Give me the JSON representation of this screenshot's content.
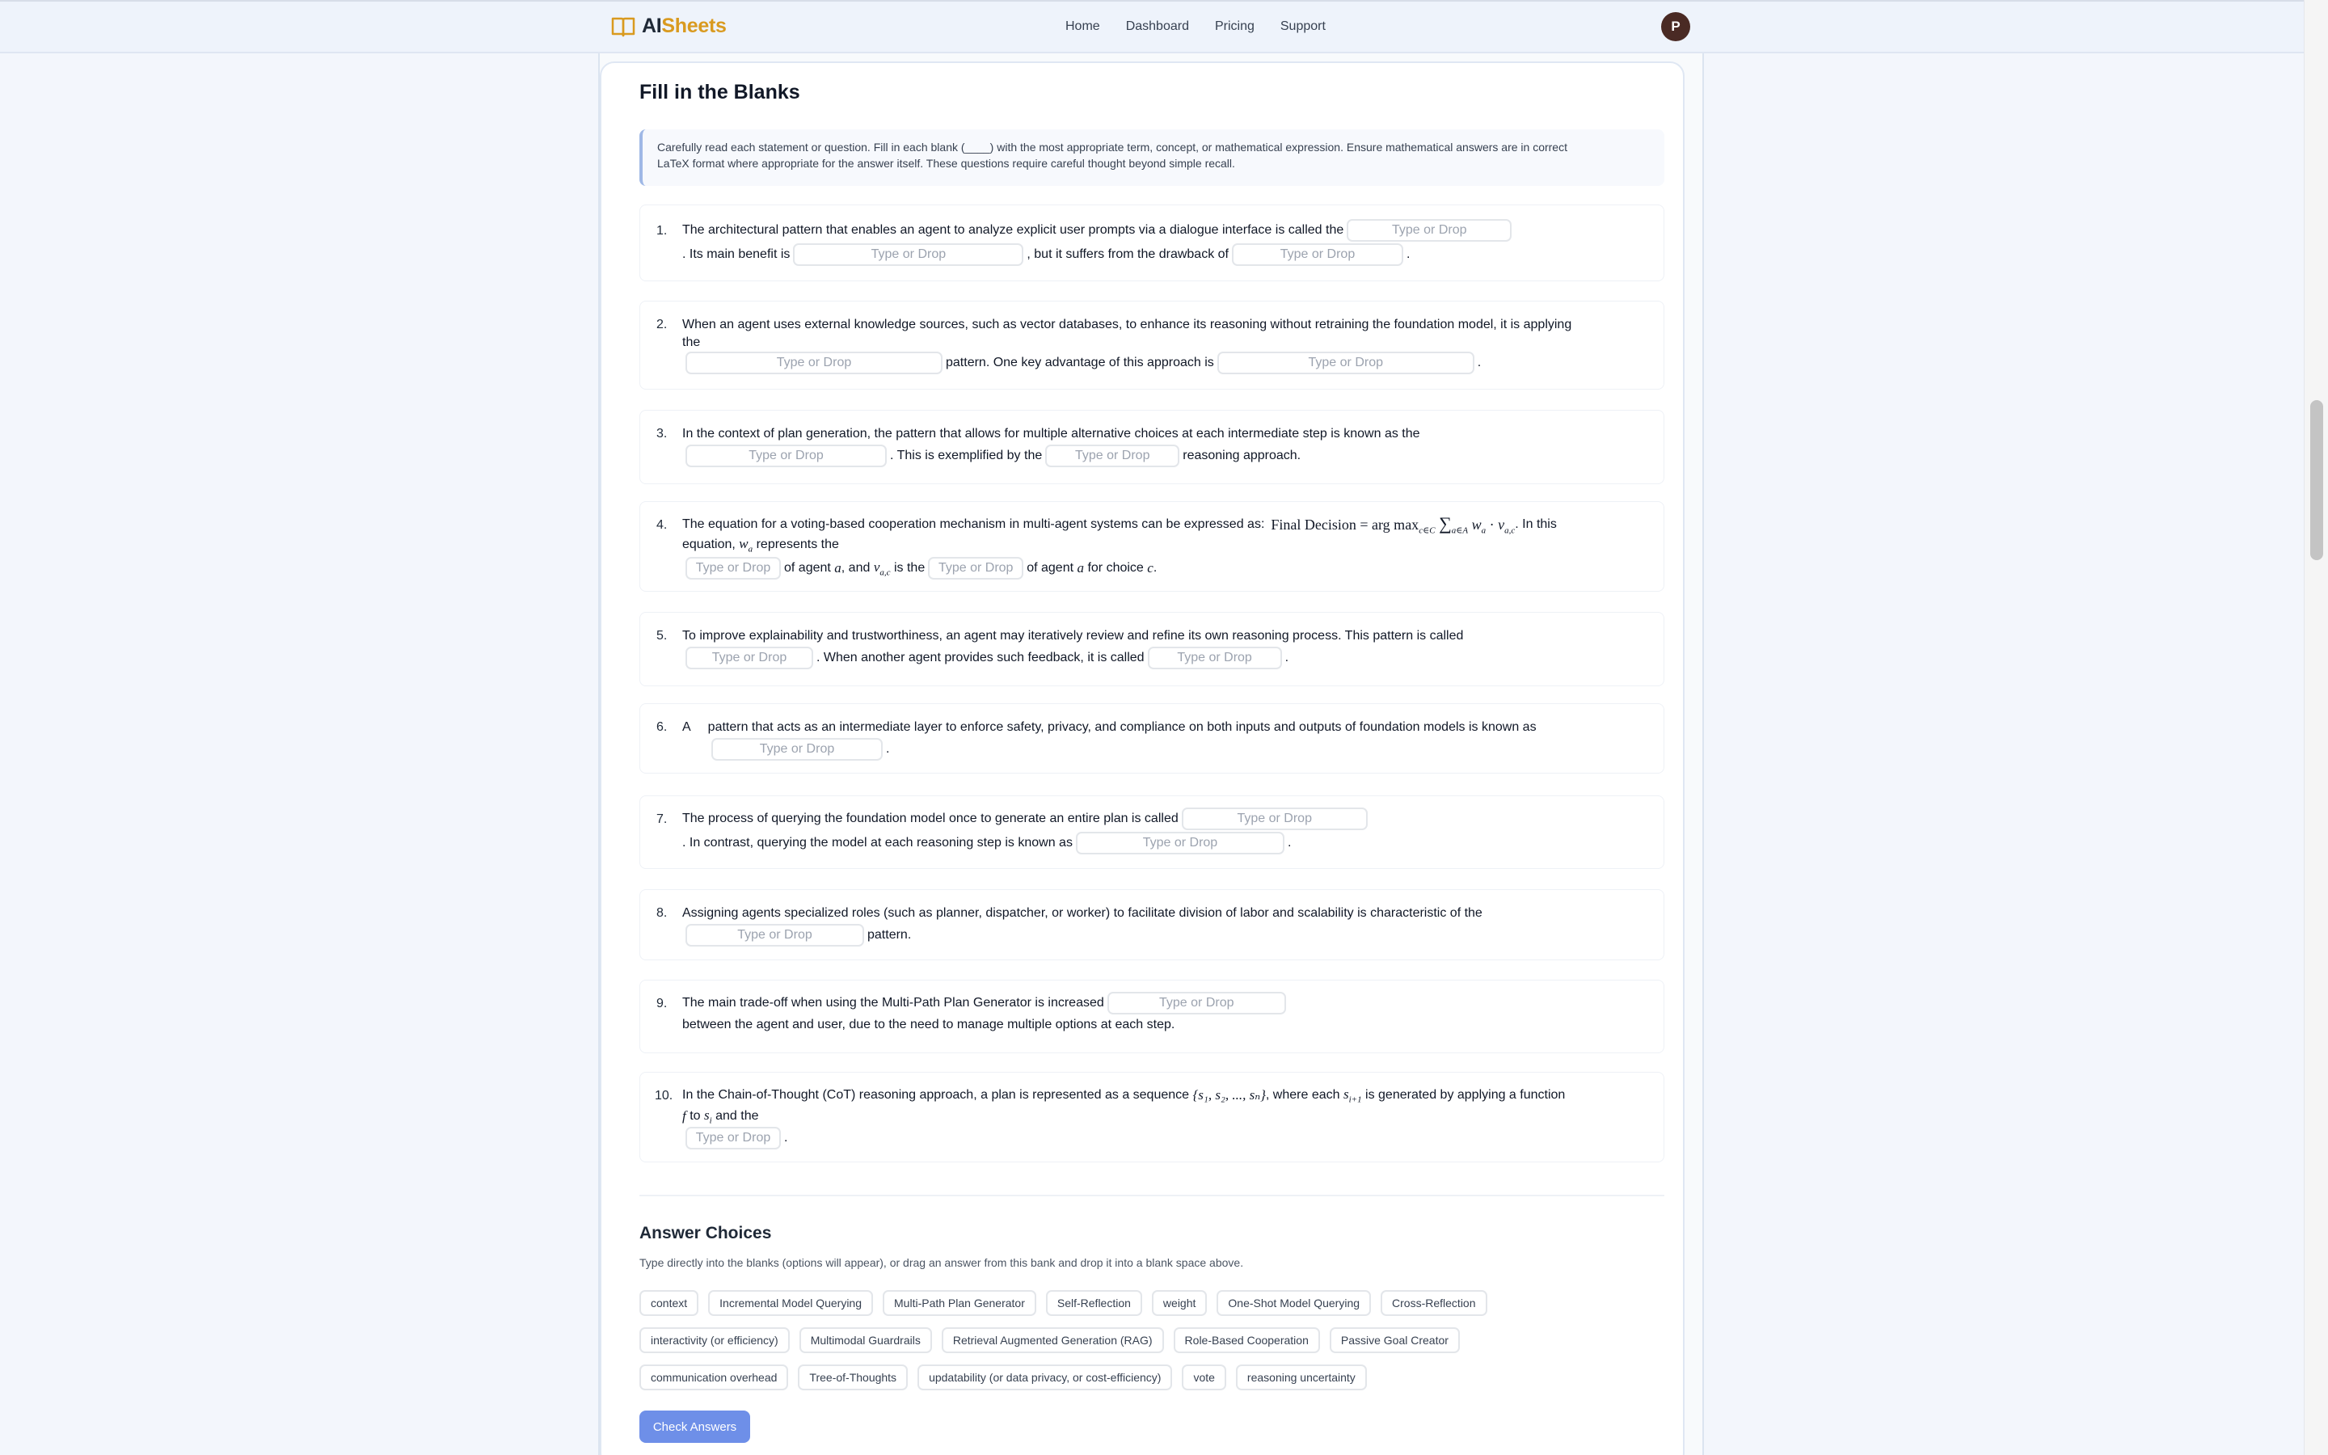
{
  "header": {
    "logo_ai": "AI",
    "logo_sheets": "Sheets",
    "nav": [
      "Home",
      "Dashboard",
      "Pricing",
      "Support"
    ],
    "avatar_initial": "P"
  },
  "section": {
    "title": "Fill in the Blanks",
    "instructions_1": "Carefully read each statement or question. Fill in each blank (____) with the most appropriate term, concept, or mathematical expression. Ensure mathematical answers are in correct",
    "instructions_2": "LaTeX format where appropriate for the answer itself. These questions require careful thought beyond simple recall."
  },
  "blank_placeholder": "Type or Drop",
  "questions": [
    {
      "num": "1.",
      "t1": "The architectural pattern that enables an agent to analyze explicit user prompts via a dialogue interface is called the",
      "t2": ". Its main benefit is",
      "t3": ", but it suffers from the drawback of",
      "t4": "."
    },
    {
      "num": "2.",
      "t1": "When an agent uses external knowledge sources, such as vector databases, to enhance its reasoning without retraining the foundation model, it is applying",
      "t2": "the",
      "t3": "pattern. One key advantage of this approach is",
      "t4": "."
    },
    {
      "num": "3.",
      "t1": "In the context of plan generation, the pattern that allows for multiple alternative choices at each intermediate step is known as the",
      "t2": ". This is exemplified by the",
      "t3": "reasoning approach."
    },
    {
      "num": "4.",
      "t1": "The equation for a voting-based cooperation mechanism in multi-agent systems can be expressed as:",
      "eq": "Final Decision = arg max",
      "eq_sub": "c∈C",
      "eq_sum": "∑",
      "eq_sum_sub": "a∈A",
      "eq_w": "w",
      "eq_w_sub": "a",
      "eq_dot": "·",
      "eq_v": "v",
      "eq_v_sub": "a,c",
      "t2": ". In this",
      "t3": "equation,",
      "w": "w",
      "w_sub": "a",
      "t4": "represents the",
      "t5": "of agent",
      "a": "a",
      "t6": ", and",
      "v": "v",
      "v_sub": "a,c",
      "t7": "is the",
      "t8": "of agent",
      "a2": "a",
      "t9": "for choice",
      "c": "c",
      "t10": "."
    },
    {
      "num": "5.",
      "t1": "To improve explainability and trustworthiness, an agent may iteratively review and refine its own reasoning process. This pattern is called",
      "t2": ". When another agent provides such feedback, it is called",
      "t3": "."
    },
    {
      "num": "6.",
      "t1": "A",
      "t2": "pattern that acts as an intermediate layer to enforce safety, privacy, and compliance on both inputs and outputs of foundation models is known as",
      "t3": "."
    },
    {
      "num": "7.",
      "t1": "The process of querying the foundation model once to generate an entire plan is called",
      "t2": ". In contrast, querying the model at each reasoning step is known as",
      "t3": "."
    },
    {
      "num": "8.",
      "t1": "Assigning agents specialized roles (such as planner, dispatcher, or worker) to facilitate division of labor and scalability is characteristic of the",
      "t2": "pattern."
    },
    {
      "num": "9.",
      "t1": "The main trade-off when using the Multi-Path Plan Generator is increased",
      "t2": "between the agent and user, due to the need to manage multiple options at each step."
    },
    {
      "num": "10.",
      "t1": "In the Chain-of-Thought (CoT) reasoning approach, a plan is represented as a sequence",
      "seq": "{s₁, s₂, ..., sₙ}",
      "t2": ", where each",
      "s": "s",
      "s_sub": "i+1",
      "t3": "is generated by applying a function",
      "f": "f",
      "t4": "to",
      "si": "s",
      "si_sub": "i",
      "t5": "and the",
      "t6": "."
    }
  ],
  "answers": {
    "title": "Answer Choices",
    "subtitle": "Type directly into the blanks (options will appear), or drag an answer from this bank and drop it into a blank space above.",
    "row1": [
      "context",
      "Incremental Model Querying",
      "Multi-Path Plan Generator",
      "Self-Reflection",
      "weight",
      "One-Shot Model Querying",
      "Cross-Reflection"
    ],
    "row2": [
      "interactivity (or efficiency)",
      "Multimodal Guardrails",
      "Retrieval Augmented Generation (RAG)",
      "Role-Based Cooperation",
      "Passive Goal Creator"
    ],
    "row3": [
      "communication overhead",
      "Tree-of-Thoughts",
      "updatability (or data privacy, or cost-efficiency)",
      "vote",
      "reasoning uncertainty"
    ],
    "check_button": "Check Answers"
  }
}
